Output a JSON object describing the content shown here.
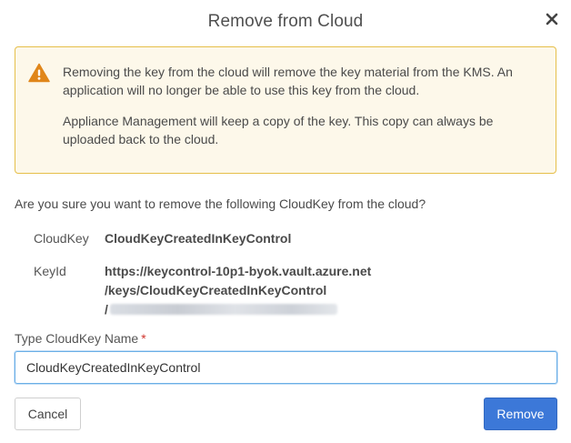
{
  "dialog": {
    "title": "Remove from Cloud",
    "close_icon": "close-icon"
  },
  "warning": {
    "icon": "warning-triangle-icon",
    "paragraph1": "Removing the key from the cloud will remove the key material from the KMS. An application will no longer be able to use this key from the cloud.",
    "paragraph2": "Appliance Management will keep a copy of the key. This copy can always be uploaded back to the cloud."
  },
  "question": "Are you sure you want to remove the following CloudKey from the cloud?",
  "details": {
    "cloudkey_label": "CloudKey",
    "cloudkey_value": "CloudKeyCreatedInKeyControl",
    "keyid_label": "KeyId",
    "keyid_line1": "https://keycontrol-10p1-byok.vault.azure.net",
    "keyid_line2": "/keys/CloudKeyCreatedInKeyControl",
    "keyid_line3_prefix": "/"
  },
  "name_field": {
    "label": "Type CloudKey Name",
    "required_marker": "*",
    "value": "CloudKeyCreatedInKeyControl"
  },
  "buttons": {
    "cancel": "Cancel",
    "remove": "Remove"
  },
  "colors": {
    "warning_border": "#e6bf4a",
    "warning_background": "#fdf8ea",
    "warning_icon": "#e0861a",
    "primary": "#3c78d8",
    "required": "#d0342c",
    "input_focus": "#6aaee6"
  }
}
